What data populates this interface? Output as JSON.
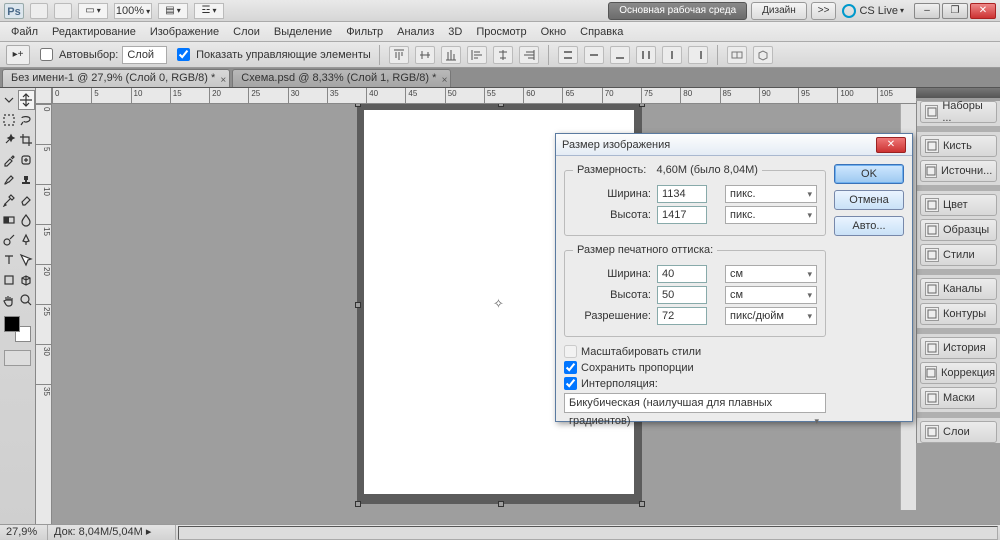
{
  "titlebar": {
    "zoom": "100%",
    "workspace_primary": "Основная рабочая среда",
    "workspace_secondary": "Дизайн",
    "more": ">>",
    "cslive": "CS Live",
    "win_min": "–",
    "win_max": "❐",
    "win_close": "✕"
  },
  "menu": [
    "Файл",
    "Редактирование",
    "Изображение",
    "Слои",
    "Выделение",
    "Фильтр",
    "Анализ",
    "3D",
    "Просмотр",
    "Окно",
    "Справка"
  ],
  "optbar": {
    "autoselect_label": "Автовыбор:",
    "autoselect_value": "Слой",
    "show_controls": "Показать управляющие элементы"
  },
  "tabs": [
    {
      "label": "Без имени-1 @ 27,9% (Слой 0, RGB/8) *",
      "active": true
    },
    {
      "label": "Схема.psd @ 8,33% (Слой 1, RGB/8) *",
      "active": false
    }
  ],
  "ruler_h": [
    "0",
    "5",
    "10",
    "15",
    "20",
    "25",
    "30",
    "35",
    "40",
    "45",
    "50",
    "55",
    "60",
    "65",
    "70",
    "75",
    "80",
    "85",
    "90",
    "95",
    "100",
    "105"
  ],
  "ruler_v": [
    "0",
    "5",
    "10",
    "15",
    "20",
    "25",
    "30",
    "35"
  ],
  "panels": [
    "Наборы ...",
    "Кисть",
    "Источни...",
    "Цвет",
    "Образцы",
    "Стили",
    "Каналы",
    "Контуры",
    "История",
    "Коррекция",
    "Маски",
    "Слои"
  ],
  "panel_groups": [
    [
      0
    ],
    [
      1,
      2
    ],
    [
      3,
      4,
      5
    ],
    [
      6,
      7
    ],
    [
      8,
      9,
      10
    ],
    [
      11
    ]
  ],
  "status": {
    "zoom": "27,9%",
    "doc": "Док: 8,04M/5,04M"
  },
  "dialog": {
    "title": "Размер изображения",
    "dimensions_label": "Размерность:",
    "dimensions_value": "4,60M (было 8,04M)",
    "px_w_label": "Ширина:",
    "px_w": "1134",
    "px_w_unit": "пикс.",
    "px_h_label": "Высота:",
    "px_h": "1417",
    "px_h_unit": "пикс.",
    "print_legend": "Размер печатного оттиска:",
    "pr_w_label": "Ширина:",
    "pr_w": "40",
    "pr_w_unit": "см",
    "pr_h_label": "Высота:",
    "pr_h": "50",
    "pr_h_unit": "см",
    "res_label": "Разрешение:",
    "res": "72",
    "res_unit": "пикс/дюйм",
    "scale_styles": "Масштабировать стили",
    "constrain": "Сохранить пропорции",
    "interpolate": "Интерполяция:",
    "interp_method": "Бикубическая (наилучшая для плавных градиентов)",
    "ok": "OK",
    "cancel": "Отмена",
    "auto": "Авто..."
  }
}
